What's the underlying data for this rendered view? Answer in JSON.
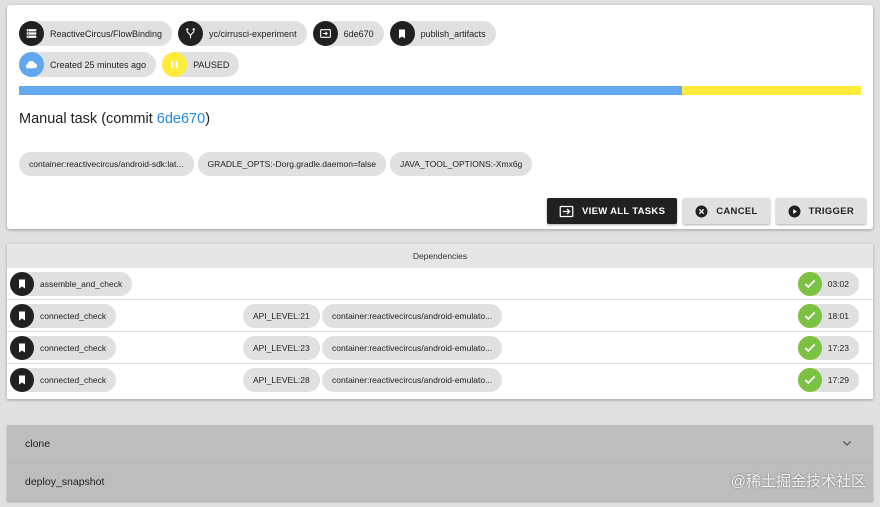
{
  "header": {
    "chips": [
      {
        "icon": "list-icon",
        "label": "ReactiveCircus/FlowBinding"
      },
      {
        "icon": "branch-icon",
        "label": "yc/cirrusci-experiment"
      },
      {
        "icon": "commit-icon",
        "label": "6de670"
      },
      {
        "icon": "bookmark-icon",
        "label": "publish_artifacts"
      }
    ],
    "created": {
      "icon": "cloud-icon",
      "label": "Created 25 minutes ago"
    },
    "status": {
      "icon": "pause-icon",
      "label": "PAUSED"
    }
  },
  "progress": {
    "done_fraction": 0.787,
    "done_color": "#64aaf0",
    "rest_color": "#ffeb3b"
  },
  "task": {
    "title_prefix": "Manual task (commit ",
    "commit": "6de670",
    "title_suffix": ")"
  },
  "env_chips": [
    "container:reactivecircus/android-sdk:lat...",
    "GRADLE_OPTS:-Dorg.gradle.daemon=false",
    "JAVA_TOOL_OPTIONS:-Xmx6g"
  ],
  "buttons": {
    "view_all": {
      "icon": "exit-icon",
      "label": "VIEW ALL TASKS"
    },
    "cancel": {
      "icon": "cancel-icon",
      "label": "CANCEL"
    },
    "trigger": {
      "icon": "play-icon",
      "label": "TRIGGER"
    }
  },
  "dependencies": {
    "header": "Dependencies",
    "rows": [
      {
        "name": "assemble_and_check",
        "api": "",
        "container": "",
        "duration": "03:02"
      },
      {
        "name": "connected_check",
        "api": "API_LEVEL:21",
        "container": "container:reactivecircus/android-emulato...",
        "duration": "18:01"
      },
      {
        "name": "connected_check",
        "api": "API_LEVEL:23",
        "container": "container:reactivecircus/android-emulato...",
        "duration": "17:23"
      },
      {
        "name": "connected_check",
        "api": "API_LEVEL:28",
        "container": "container:reactivecircus/android-emulato...",
        "duration": "17:29"
      }
    ]
  },
  "accordions": [
    {
      "label": "clone",
      "icon": "chevron-down-icon"
    },
    {
      "label": "deploy_snapshot"
    }
  ],
  "watermark": "@稀土掘金技术社区"
}
